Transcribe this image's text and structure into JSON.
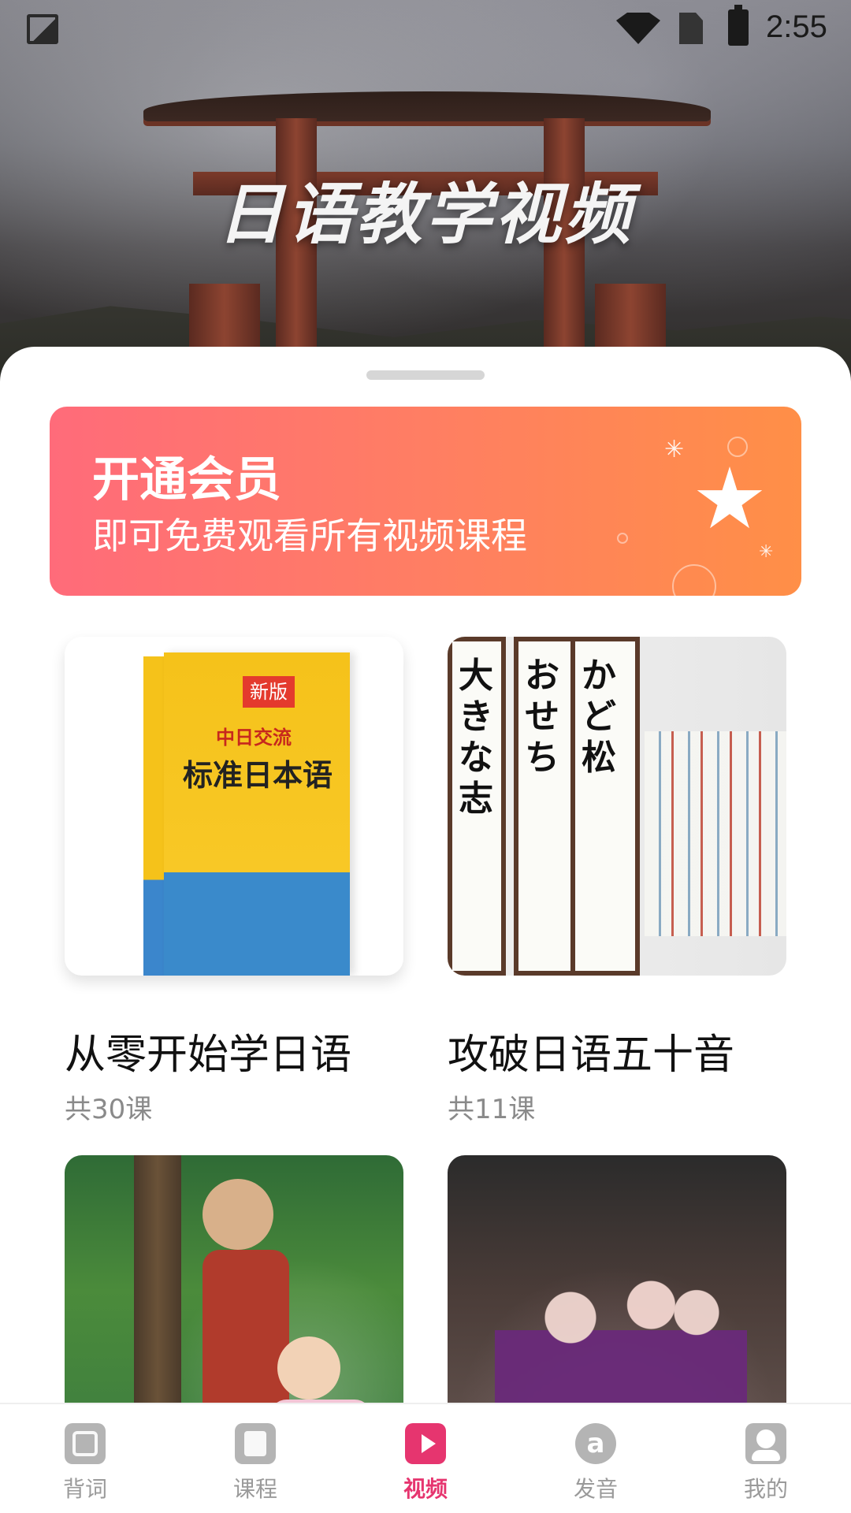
{
  "status_bar": {
    "time": "2:55",
    "icons": [
      "image-icon",
      "wifi-icon",
      "no-sim-icon",
      "battery-charging-icon"
    ]
  },
  "hero": {
    "title": "日语教学视频"
  },
  "vip": {
    "title": "开通会员",
    "subtitle": "即可免费观看所有视频课程",
    "icon": "star-icon"
  },
  "courses": [
    {
      "title": "从零开始学日语",
      "lessons": "共30课",
      "thumbnail": {
        "book_tag": "新版",
        "book_brand": "中日交流",
        "book_title": "标准日本语"
      }
    },
    {
      "title": "攻破日语五十音",
      "lessons": "共11课",
      "thumbnail": {
        "scroll_1": "大きな志",
        "scroll_2": "おせち",
        "scroll_3": "かど松"
      }
    },
    {
      "title": "",
      "lessons": ""
    },
    {
      "title": "",
      "lessons": ""
    }
  ],
  "bottom_nav": {
    "items": [
      {
        "label": "背词",
        "icon": "vocabulary-icon",
        "active": false
      },
      {
        "label": "课程",
        "icon": "book-icon",
        "active": false
      },
      {
        "label": "视频",
        "icon": "video-play-icon",
        "active": true
      },
      {
        "label": "发音",
        "icon": "at-sign-icon",
        "active": false
      },
      {
        "label": "我的",
        "icon": "user-icon",
        "active": false
      }
    ]
  },
  "colors": {
    "accent": "#e6356f",
    "vip_gradient_start": "#ff6b7a",
    "vip_gradient_end": "#ff8f47",
    "inactive_icon": "#b4b4b4",
    "inactive_text": "#9a9a9a"
  }
}
